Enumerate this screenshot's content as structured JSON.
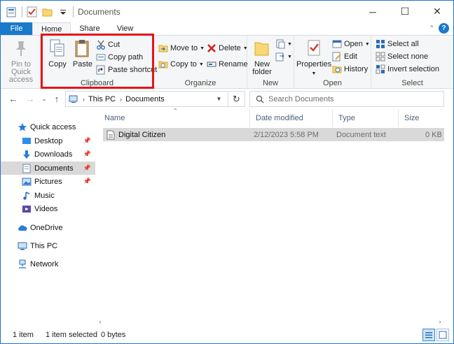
{
  "window": {
    "title": "Documents"
  },
  "ribbon_tabs": {
    "file": "File",
    "home": "Home",
    "share": "Share",
    "view": "View"
  },
  "ribbon": {
    "pin_to_quick_access": "Pin to Quick access",
    "copy": "Copy",
    "paste": "Paste",
    "cut": "Cut",
    "copy_path": "Copy path",
    "paste_shortcut": "Paste shortcut",
    "clipboard_group": "Clipboard",
    "move_to": "Move to",
    "copy_to": "Copy to",
    "delete": "Delete",
    "rename": "Rename",
    "organize_group": "Organize",
    "new_folder_line1": "New",
    "new_folder_line2": "folder",
    "new_group": "New",
    "properties": "Properties",
    "open": "Open",
    "edit": "Edit",
    "history": "History",
    "open_group": "Open",
    "select_all": "Select all",
    "select_none": "Select none",
    "invert_selection": "Invert selection",
    "select_group": "Select"
  },
  "address": {
    "crumbs": [
      "This PC",
      "Documents"
    ],
    "search_placeholder": "Search Documents"
  },
  "nav": {
    "quick_access": "Quick access",
    "desktop": "Desktop",
    "downloads": "Downloads",
    "documents": "Documents",
    "pictures": "Pictures",
    "music": "Music",
    "videos": "Videos",
    "onedrive": "OneDrive",
    "this_pc": "This PC",
    "network": "Network"
  },
  "columns": {
    "name": "Name",
    "date": "Date modified",
    "type": "Type",
    "size": "Size"
  },
  "files": [
    {
      "name": "Digital Citizen",
      "date": "2/12/2023 5:58 PM",
      "type": "Document text",
      "size": "0 KB"
    }
  ],
  "status": {
    "items": "1 item",
    "selected": "1 item selected",
    "bytes": "0 bytes"
  },
  "colors": {
    "accent": "#1979ca",
    "highlight_box": "#e4141b",
    "selection": "#d9d9d9"
  }
}
